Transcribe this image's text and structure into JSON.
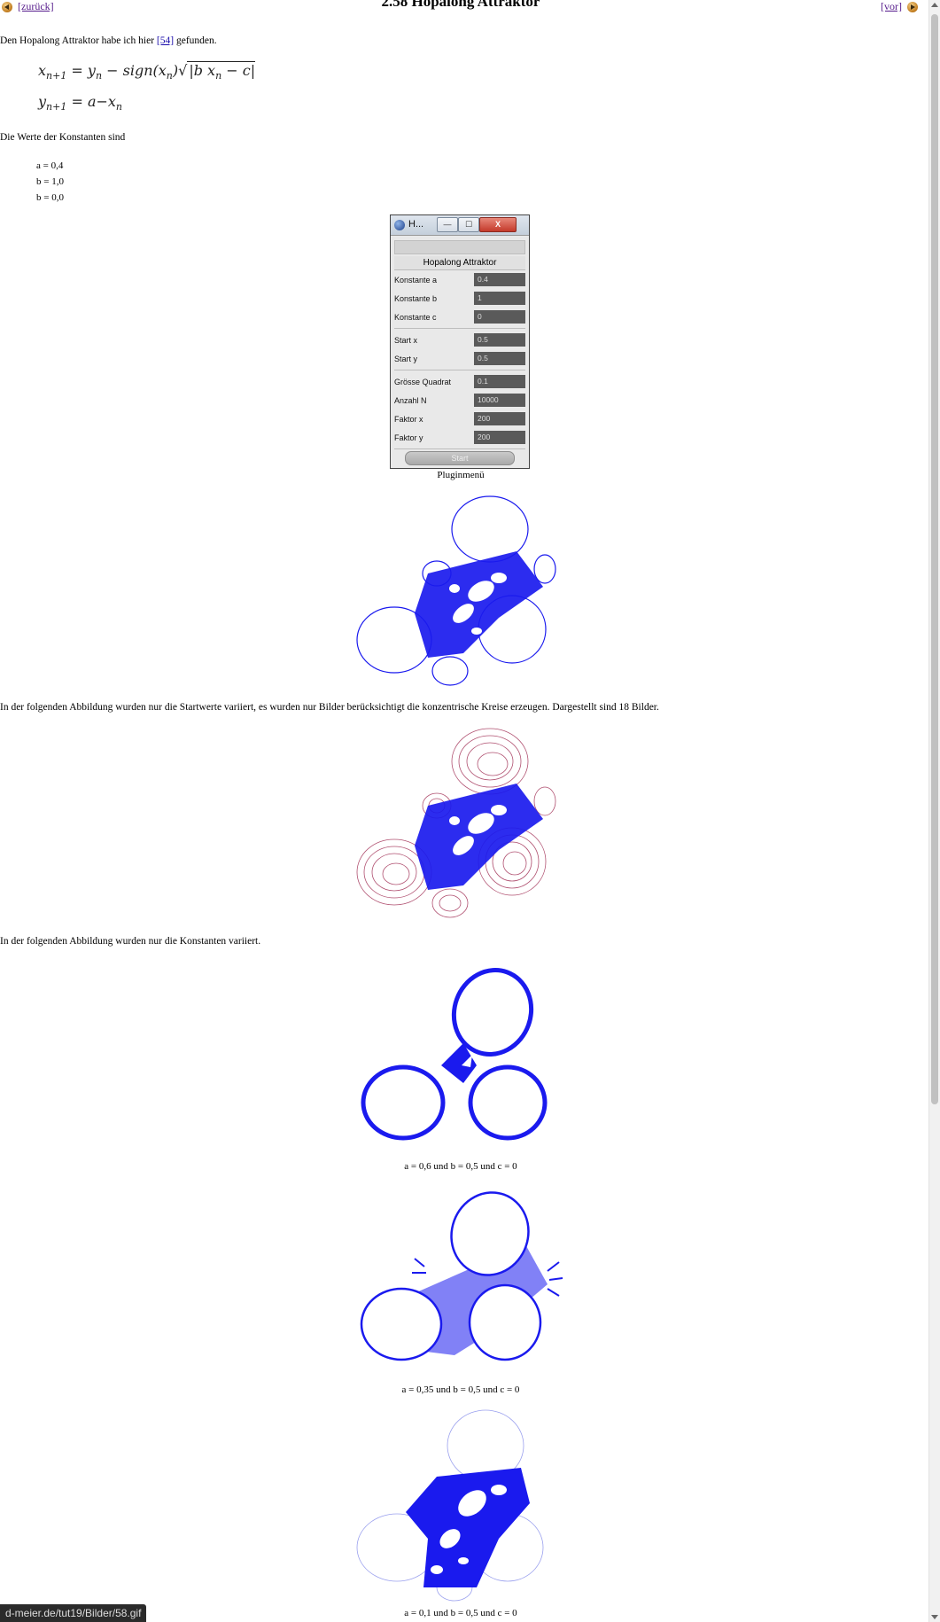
{
  "nav": {
    "back_label": "[zurück]",
    "next_label": "[vor]"
  },
  "title": "2.58 Hopalong Attraktor",
  "intro": {
    "before": "Den Hopalong Attraktor habe ich hier ",
    "ref": "[54]",
    "after": " gefunden."
  },
  "formula": {
    "line1": {
      "lhs": "x",
      "lhs_sub": "n+1",
      "mid": " = y",
      "mid_sub": "n",
      "sign": " − sign(x",
      "sign_sub": "n",
      "sign_close": ")",
      "sqrt_body": "|b x",
      "sqrt_sub": "n",
      "sqrt_tail": " − c|"
    },
    "line2": {
      "lhs": "y",
      "lhs_sub": "n+1",
      "rhs": " = a−x",
      "rhs_sub": "n"
    }
  },
  "constants_intro": "Die Werte der Konstanten sind",
  "constants": [
    "a = 0,4",
    "b = 1,0",
    "b = 0,0"
  ],
  "plugin": {
    "window_title": "H...",
    "min_label": "—",
    "max_label": "☐",
    "close_label": "X",
    "panel_title": "Hopalong Attraktor",
    "group1": [
      {
        "label": "Konstante a",
        "value": "0.4"
      },
      {
        "label": "Konstante b",
        "value": "1"
      },
      {
        "label": "Konstante c",
        "value": "0"
      }
    ],
    "group2": [
      {
        "label": "Start x",
        "value": "0.5"
      },
      {
        "label": "Start y",
        "value": "0.5"
      }
    ],
    "group3": [
      {
        "label": "Grösse Quadrat",
        "value": "0.1"
      },
      {
        "label": "Anzahl N",
        "value": "10000"
      },
      {
        "label": "Faktor x",
        "value": "200"
      },
      {
        "label": "Faktor y",
        "value": "200"
      }
    ],
    "start_label": "Start",
    "caption": "Pluginmenü"
  },
  "para_start": "In der folgenden Abbildung wurden nur die Startwerte variiert, es wurden nur Bilder berücksichtigt die konzentrische Kreise erzeugen. Dargestellt sind 18 Bilder.",
  "para_const": "In der folgenden Abbildung wurden nur die Konstanten variiert.",
  "captions": {
    "fig3": "a = 0,6 und b = 0,5 und c = 0",
    "fig4": "a = 0,35 und b = 0,5 und c = 0",
    "fig5": "a = 0,1 und b = 0,5 und c = 0"
  },
  "status_url": "d-meier.de/tut19/Bilder/58.gif",
  "colors": {
    "attractor": "#1a1aee",
    "concentric": "#b05070",
    "link": "#551a8b"
  }
}
